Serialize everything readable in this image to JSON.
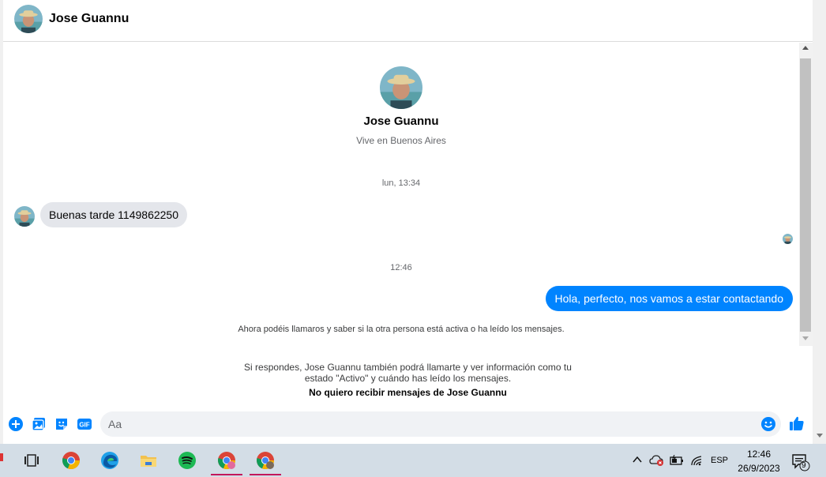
{
  "contact": {
    "name": "Jose Guannu",
    "location": "Vive en Buenos Aires"
  },
  "thread": {
    "timestamp_1": "lun, 13:34",
    "incoming_message": "Buenas tarde 1149862250",
    "timestamp_2": "12:46",
    "outgoing_message": "Hola, perfecto, nos vamos a estar contactando",
    "call_notice": "Ahora podéis llamaros y saber si la otra persona está activa o ha leído los mensajes."
  },
  "footer": {
    "info_line_1": "Si respondes, Jose Guannu también podrá llamarte y ver información como tu",
    "info_line_2": "estado \"Activo\" y cuándo has leído los mensajes.",
    "opt_out_link": "No quiero recibir mensajes de Jose Guannu"
  },
  "composer": {
    "placeholder": "Aa",
    "value": "",
    "icons": [
      "plus-circle-icon",
      "photo-icon",
      "sticker-icon",
      "gif-icon",
      "emoji-icon",
      "thumbs-up-icon"
    ],
    "gif_label": "GIF"
  },
  "colors": {
    "accent": "#0084ff",
    "incoming_bubble": "#e4e6eb",
    "taskbar": "#d3dde6"
  },
  "taskbar": {
    "apps": [
      "task-view-icon",
      "chrome-icon",
      "edge-icon",
      "file-explorer-icon",
      "spotify-icon",
      "chrome-profile-icon",
      "chrome-profile-2-icon"
    ],
    "language": "ESP",
    "time": "12:46",
    "date": "26/9/2023",
    "notification_count": "9"
  }
}
